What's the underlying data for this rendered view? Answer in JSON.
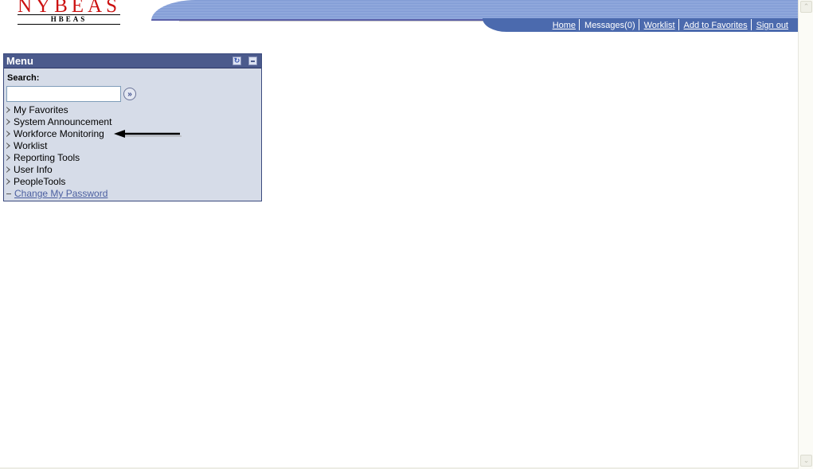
{
  "header": {
    "logo_main": "NYBEAS",
    "logo_sub": "HBEAS",
    "nav_links": [
      {
        "label": "Home"
      },
      {
        "label": "Messages(0)"
      },
      {
        "label": "Worklist"
      },
      {
        "label": "Add to Favorites"
      },
      {
        "label": "Sign out"
      }
    ]
  },
  "menu": {
    "title": "Menu",
    "refresh_icon": "refresh-icon",
    "minimize_icon": "minimize-icon",
    "search_label": "Search:",
    "search_value": "",
    "search_go_icon": "double-chevron-right-icon",
    "items": [
      {
        "label": "My Favorites",
        "type": "folder"
      },
      {
        "label": "System Announcement",
        "type": "folder"
      },
      {
        "label": "Workforce Monitoring",
        "type": "folder"
      },
      {
        "label": "Worklist",
        "type": "folder"
      },
      {
        "label": "Reporting Tools",
        "type": "folder"
      },
      {
        "label": "User Info",
        "type": "folder"
      },
      {
        "label": "PeopleTools",
        "type": "folder"
      },
      {
        "label": "Change My Password",
        "type": "link"
      }
    ]
  },
  "annotation": {
    "arrow_target": "Workforce Monitoring"
  },
  "colors": {
    "banner_blue": "#4b6aae",
    "menu_header": "#4b5a8c",
    "menu_bg": "#d6dce8",
    "logo_red": "#cc1111",
    "link_blue": "#4b5fa0"
  }
}
